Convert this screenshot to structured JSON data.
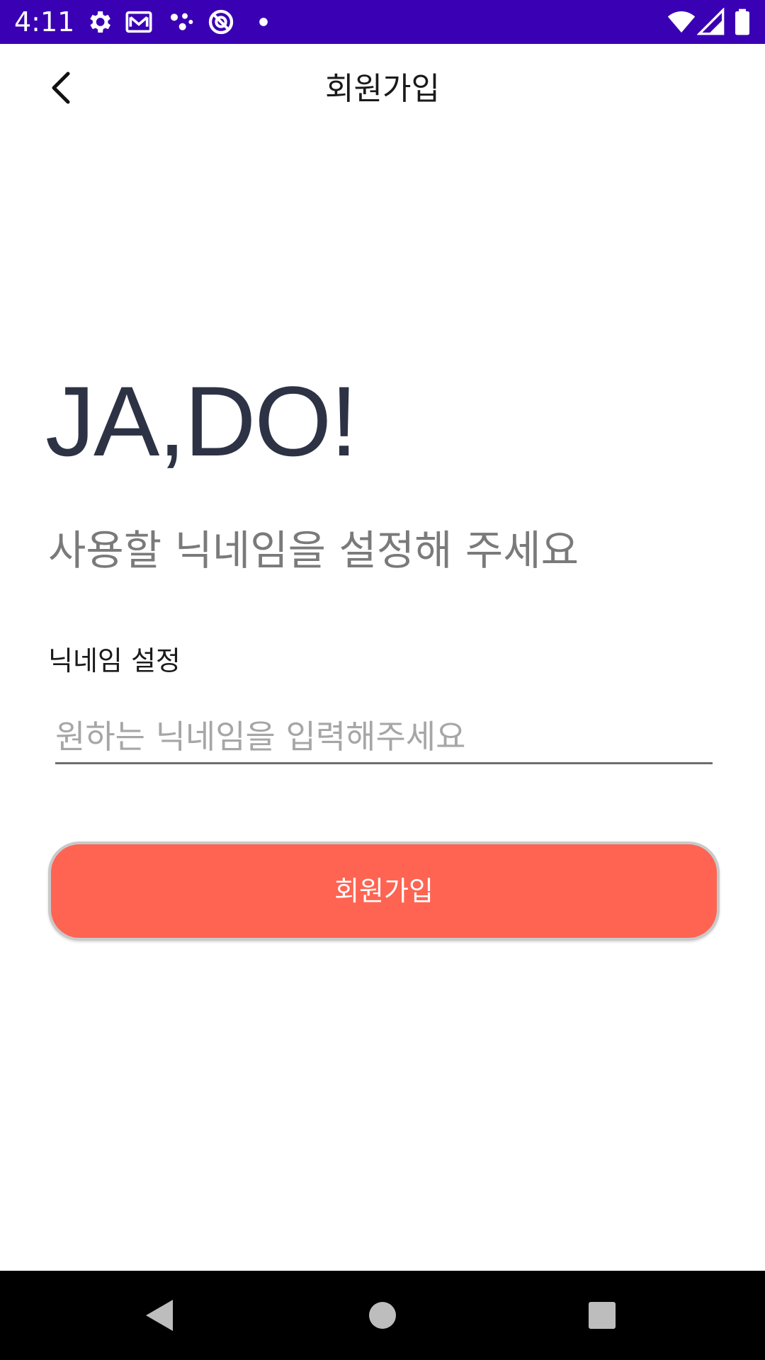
{
  "status_bar": {
    "time": "4:11",
    "background_color": "#3a00b4",
    "left_icons": [
      "gear-icon",
      "gmail-icon",
      "dots-icon",
      "data-saver-icon",
      "small-dot-icon"
    ],
    "right_icons": [
      "wifi-icon",
      "cellular-signal-icon",
      "battery-icon"
    ]
  },
  "app_bar": {
    "title": "회원가입",
    "back_icon": "chevron-left-icon"
  },
  "main": {
    "logo": "JA,DO!",
    "subtitle": "사용할 닉네임을 설정해 주세요",
    "field_label": "닉네임 설정",
    "nickname_placeholder": "원하는 닉네임을 입력해주세요",
    "nickname_value": "",
    "signup_button_label": "회원가입",
    "accent_color": "#ff6453",
    "logo_color": "#2d3345"
  },
  "nav_bar": {
    "icons": [
      "back-triangle-icon",
      "home-circle-icon",
      "recents-square-icon"
    ]
  }
}
